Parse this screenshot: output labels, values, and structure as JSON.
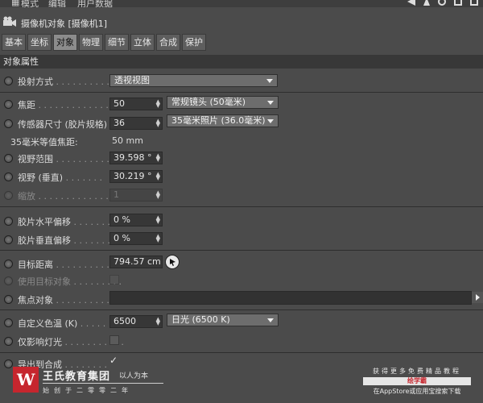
{
  "menubar": {
    "items": [
      "模式",
      "编辑",
      "用户数据"
    ]
  },
  "header": {
    "title": "摄像机对象 [摄像机1]"
  },
  "tabs": [
    "基本",
    "坐标",
    "对象",
    "物理",
    "细节",
    "立体",
    "合成",
    "保护"
  ],
  "active_tab": "对象",
  "section": {
    "title": "对象属性"
  },
  "props": {
    "projection": {
      "label": "投射方式",
      "value": "透视视图"
    },
    "focal": {
      "label": "焦距",
      "value": "50",
      "preset": "常规镜头 (50毫米)"
    },
    "sensor": {
      "label": "传感器尺寸 (胶片规格)",
      "value": "36",
      "preset": "35毫米照片 (36.0毫米)"
    },
    "equiv": {
      "label": "35毫米等值焦距:",
      "value": "50 mm"
    },
    "fov": {
      "label": "视野范围",
      "value": "39.598 °"
    },
    "fov_v": {
      "label": "视野 (垂直)",
      "value": "30.219 °"
    },
    "zoom": {
      "label": "缩放",
      "value": "1"
    },
    "film_h": {
      "label": "胶片水平偏移",
      "value": "0 %"
    },
    "film_v": {
      "label": "胶片垂直偏移",
      "value": "0 %"
    },
    "target_dist": {
      "label": "目标距离",
      "value": "794.57 cm"
    },
    "use_target": {
      "label": "使用目标对象"
    },
    "focus_obj": {
      "label": "焦点对象"
    },
    "color_temp": {
      "label": "自定义色温 (K)",
      "value": "6500",
      "preset": "日光 (6500 K)"
    },
    "affect_lights": {
      "label": "仅影响灯光"
    },
    "export": {
      "label": "导出到合成"
    }
  },
  "brand": {
    "name": "王氏教育集团",
    "slogan": "以人为本",
    "since": "始创于二零零二年"
  },
  "promo": {
    "line1": "获得更多免费精品教程",
    "line2": "绘学霸",
    "line3": "在AppStore或应用宝搜索下载"
  },
  "colors": {
    "accent": "#c6262e",
    "panel": "#4b4b4b",
    "field": "#373737",
    "dropdown": "#6d6d6d"
  }
}
